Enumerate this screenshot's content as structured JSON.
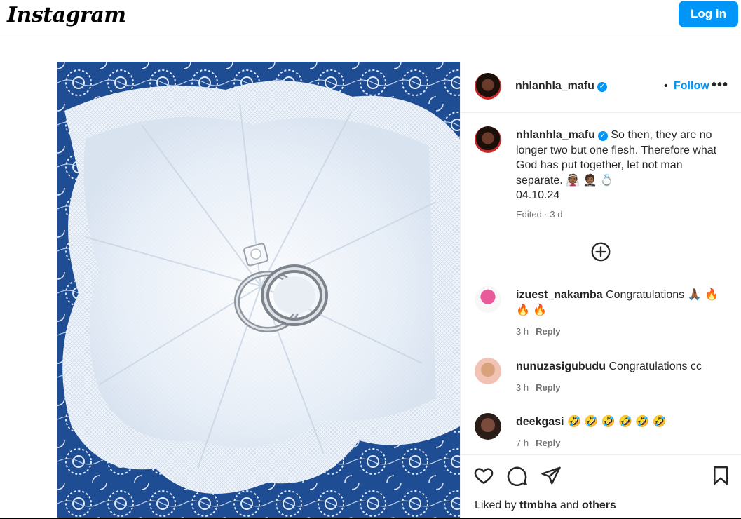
{
  "header": {
    "logo_text": "Instagram",
    "login_label": "Log in"
  },
  "post": {
    "image_description_icon": "wedding-rings-photo",
    "author": {
      "username": "nhlanhla_mafu",
      "verified_icon": "verified-badge-icon",
      "separator": "•",
      "follow_label": "Follow",
      "more_icon": "more-options-icon",
      "more_label": "•••"
    },
    "caption": {
      "username": "nhlanhla_mafu",
      "text": "So then, they are no longer two but one flesh. Therefore what God has put together, let not man separate. 👰🏾 🤵🏾 💍",
      "date": "04.10.24",
      "meta": "Edited · 3 d"
    },
    "load_more_icon": "add-circle-icon",
    "comments": [
      {
        "username": "izuest_nakamba",
        "text": "Congratulations 🙏🏾 🔥 🔥 🔥",
        "time": "3 h",
        "reply_label": "Reply"
      },
      {
        "username": "nunuzasigubudu",
        "text": "Congratulations cc",
        "time": "3 h",
        "reply_label": "Reply"
      },
      {
        "username": "deekgasi",
        "text": "🤣 🤣 🤣 🤣 🤣 🤣",
        "time": "7 h",
        "reply_label": "Reply"
      }
    ],
    "actions": {
      "like_icon": "heart-icon",
      "comment_icon": "comment-icon",
      "share_icon": "share-icon",
      "save_icon": "bookmark-icon"
    },
    "likes": {
      "prefix": "Liked by",
      "user": "ttmbha",
      "conjunction": "and",
      "others": "others"
    }
  },
  "colors": {
    "accent": "#0095f6",
    "text": "#262626",
    "muted": "#737373",
    "border": "#dbdbdb"
  }
}
